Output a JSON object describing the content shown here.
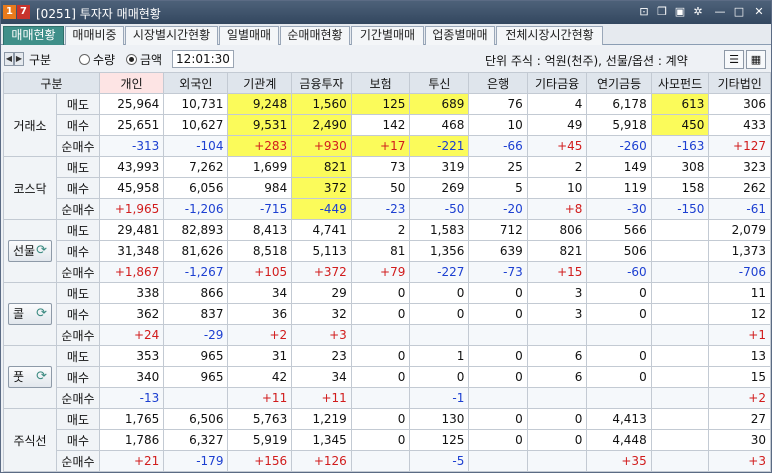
{
  "window": {
    "badge1": "1",
    "badge2": "7",
    "title": "[0251] 투자자 매매현황"
  },
  "title_icons": [
    "dock-icon",
    "copy-icon",
    "camera-icon",
    "settings-icon",
    "minimize-icon",
    "maximize-icon",
    "close-icon"
  ],
  "tabs": [
    "매매현황",
    "매매비중",
    "시장별시간현황",
    "일별매매",
    "순매매현황",
    "기간별매매",
    "업종별매매",
    "전체시장시간현황"
  ],
  "toolbar": {
    "prev": "◀",
    "next": "▶",
    "gubun_label": "구분",
    "radio_qty": "수량",
    "radio_amt": "금액",
    "time": "12:01:30",
    "unit_info": "단위 주식 : 억원(천주), 선물/옵션 : 계약"
  },
  "headers": [
    "구분",
    "개인",
    "외국인",
    "기관계",
    "금융투자",
    "보험",
    "투신",
    "은행",
    "기타금융",
    "연기금등",
    "사모펀드",
    "기타법인"
  ],
  "groups": [
    {
      "name": "거래소",
      "button": false,
      "rows": [
        {
          "label": "매도",
          "values": [
            "25,964",
            "10,731",
            "9,248",
            "1,560",
            "125",
            "689",
            "76",
            "4",
            "6,178",
            "613",
            "306"
          ]
        },
        {
          "label": "매수",
          "values": [
            "25,651",
            "10,627",
            "9,531",
            "2,490",
            "142",
            "468",
            "10",
            "49",
            "5,918",
            "450",
            "433"
          ]
        },
        {
          "label": "순매수",
          "values": [
            "-313",
            "-104",
            "+283",
            "+930",
            "+17",
            "-221",
            "-66",
            "+45",
            "-260",
            "-163",
            "+127"
          ]
        }
      ]
    },
    {
      "name": "코스닥",
      "button": false,
      "rows": [
        {
          "label": "매도",
          "values": [
            "43,993",
            "7,262",
            "1,699",
            "821",
            "73",
            "319",
            "25",
            "2",
            "149",
            "308",
            "323"
          ]
        },
        {
          "label": "매수",
          "values": [
            "45,958",
            "6,056",
            "984",
            "372",
            "50",
            "269",
            "5",
            "10",
            "119",
            "158",
            "262"
          ]
        },
        {
          "label": "순매수",
          "values": [
            "+1,965",
            "-1,206",
            "-715",
            "-449",
            "-23",
            "-50",
            "-20",
            "+8",
            "-30",
            "-150",
            "-61"
          ]
        }
      ]
    },
    {
      "name": "선물",
      "button": true,
      "rows": [
        {
          "label": "매도",
          "values": [
            "29,481",
            "82,893",
            "8,413",
            "4,741",
            "2",
            "1,583",
            "712",
            "806",
            "566",
            "",
            "2,079"
          ]
        },
        {
          "label": "매수",
          "values": [
            "31,348",
            "81,626",
            "8,518",
            "5,113",
            "81",
            "1,356",
            "639",
            "821",
            "506",
            "",
            "1,373"
          ]
        },
        {
          "label": "순매수",
          "values": [
            "+1,867",
            "-1,267",
            "+105",
            "+372",
            "+79",
            "-227",
            "-73",
            "+15",
            "-60",
            "",
            "-706"
          ]
        }
      ]
    },
    {
      "name": "콜",
      "button": true,
      "rows": [
        {
          "label": "매도",
          "values": [
            "338",
            "866",
            "34",
            "29",
            "0",
            "0",
            "0",
            "3",
            "0",
            "",
            "11"
          ]
        },
        {
          "label": "매수",
          "values": [
            "362",
            "837",
            "36",
            "32",
            "0",
            "0",
            "0",
            "3",
            "0",
            "",
            "12"
          ]
        },
        {
          "label": "순매수",
          "values": [
            "+24",
            "-29",
            "+2",
            "+3",
            "",
            "",
            "",
            "",
            "",
            "",
            "+1"
          ]
        }
      ]
    },
    {
      "name": "풋",
      "button": true,
      "rows": [
        {
          "label": "매도",
          "values": [
            "353",
            "965",
            "31",
            "23",
            "0",
            "1",
            "0",
            "6",
            "0",
            "",
            "13"
          ]
        },
        {
          "label": "매수",
          "values": [
            "340",
            "965",
            "42",
            "34",
            "0",
            "0",
            "0",
            "6",
            "0",
            "",
            "15"
          ]
        },
        {
          "label": "순매수",
          "values": [
            "-13",
            "",
            "+11",
            "+11",
            "",
            "-1",
            "",
            "",
            "",
            "",
            "+2"
          ]
        }
      ]
    },
    {
      "name": "주식선",
      "button": false,
      "rows": [
        {
          "label": "매도",
          "values": [
            "1,765",
            "6,506",
            "5,763",
            "1,219",
            "0",
            "130",
            "0",
            "0",
            "4,413",
            "",
            "27"
          ]
        },
        {
          "label": "매수",
          "values": [
            "1,786",
            "6,327",
            "5,919",
            "1,345",
            "0",
            "125",
            "0",
            "0",
            "4,448",
            "",
            "30"
          ]
        },
        {
          "label": "순매수",
          "values": [
            "+21",
            "-179",
            "+156",
            "+126",
            "",
            "-5",
            "",
            "",
            "+35",
            "",
            "+3"
          ]
        }
      ]
    }
  ],
  "highlights": {
    "0": [
      [
        2,
        3,
        4,
        5,
        9
      ],
      [
        2,
        3,
        9
      ],
      [
        2,
        3,
        4,
        5
      ]
    ],
    "1": [
      [
        3
      ],
      [
        3
      ],
      [
        3
      ]
    ]
  },
  "colors": {
    "positive": "#d11c1c",
    "negative": "#1c3fd1",
    "highlight": "#fbfb5a",
    "active_tab": "#3f8f89",
    "titlebar": "#3c5069"
  }
}
